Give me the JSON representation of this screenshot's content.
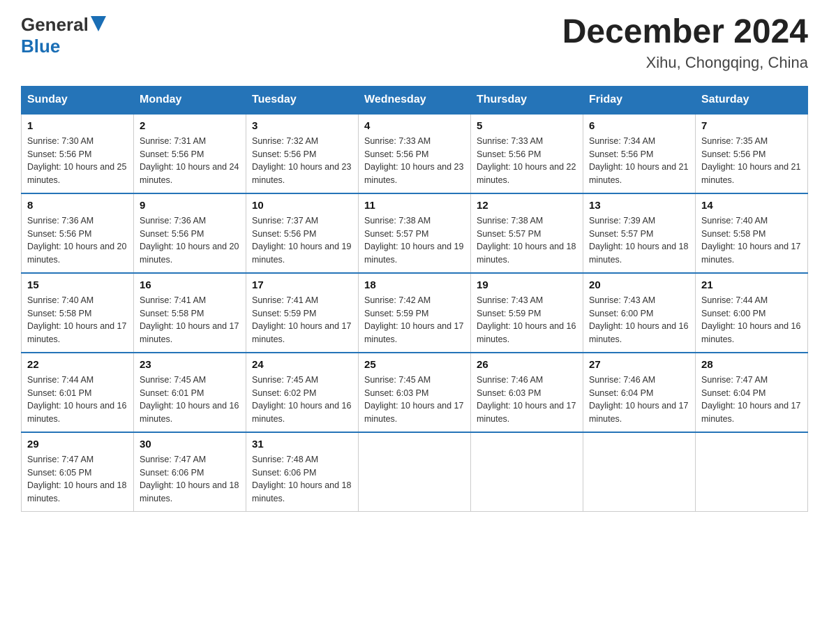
{
  "header": {
    "logo_general": "General",
    "logo_blue": "Blue",
    "month_title": "December 2024",
    "location": "Xihu, Chongqing, China"
  },
  "weekdays": [
    "Sunday",
    "Monday",
    "Tuesday",
    "Wednesday",
    "Thursday",
    "Friday",
    "Saturday"
  ],
  "weeks": [
    [
      {
        "day": "1",
        "sunrise": "7:30 AM",
        "sunset": "5:56 PM",
        "daylight": "10 hours and 25 minutes."
      },
      {
        "day": "2",
        "sunrise": "7:31 AM",
        "sunset": "5:56 PM",
        "daylight": "10 hours and 24 minutes."
      },
      {
        "day": "3",
        "sunrise": "7:32 AM",
        "sunset": "5:56 PM",
        "daylight": "10 hours and 23 minutes."
      },
      {
        "day": "4",
        "sunrise": "7:33 AM",
        "sunset": "5:56 PM",
        "daylight": "10 hours and 23 minutes."
      },
      {
        "day": "5",
        "sunrise": "7:33 AM",
        "sunset": "5:56 PM",
        "daylight": "10 hours and 22 minutes."
      },
      {
        "day": "6",
        "sunrise": "7:34 AM",
        "sunset": "5:56 PM",
        "daylight": "10 hours and 21 minutes."
      },
      {
        "day": "7",
        "sunrise": "7:35 AM",
        "sunset": "5:56 PM",
        "daylight": "10 hours and 21 minutes."
      }
    ],
    [
      {
        "day": "8",
        "sunrise": "7:36 AM",
        "sunset": "5:56 PM",
        "daylight": "10 hours and 20 minutes."
      },
      {
        "day": "9",
        "sunrise": "7:36 AM",
        "sunset": "5:56 PM",
        "daylight": "10 hours and 20 minutes."
      },
      {
        "day": "10",
        "sunrise": "7:37 AM",
        "sunset": "5:56 PM",
        "daylight": "10 hours and 19 minutes."
      },
      {
        "day": "11",
        "sunrise": "7:38 AM",
        "sunset": "5:57 PM",
        "daylight": "10 hours and 19 minutes."
      },
      {
        "day": "12",
        "sunrise": "7:38 AM",
        "sunset": "5:57 PM",
        "daylight": "10 hours and 18 minutes."
      },
      {
        "day": "13",
        "sunrise": "7:39 AM",
        "sunset": "5:57 PM",
        "daylight": "10 hours and 18 minutes."
      },
      {
        "day": "14",
        "sunrise": "7:40 AM",
        "sunset": "5:58 PM",
        "daylight": "10 hours and 17 minutes."
      }
    ],
    [
      {
        "day": "15",
        "sunrise": "7:40 AM",
        "sunset": "5:58 PM",
        "daylight": "10 hours and 17 minutes."
      },
      {
        "day": "16",
        "sunrise": "7:41 AM",
        "sunset": "5:58 PM",
        "daylight": "10 hours and 17 minutes."
      },
      {
        "day": "17",
        "sunrise": "7:41 AM",
        "sunset": "5:59 PM",
        "daylight": "10 hours and 17 minutes."
      },
      {
        "day": "18",
        "sunrise": "7:42 AM",
        "sunset": "5:59 PM",
        "daylight": "10 hours and 17 minutes."
      },
      {
        "day": "19",
        "sunrise": "7:43 AM",
        "sunset": "5:59 PM",
        "daylight": "10 hours and 16 minutes."
      },
      {
        "day": "20",
        "sunrise": "7:43 AM",
        "sunset": "6:00 PM",
        "daylight": "10 hours and 16 minutes."
      },
      {
        "day": "21",
        "sunrise": "7:44 AM",
        "sunset": "6:00 PM",
        "daylight": "10 hours and 16 minutes."
      }
    ],
    [
      {
        "day": "22",
        "sunrise": "7:44 AM",
        "sunset": "6:01 PM",
        "daylight": "10 hours and 16 minutes."
      },
      {
        "day": "23",
        "sunrise": "7:45 AM",
        "sunset": "6:01 PM",
        "daylight": "10 hours and 16 minutes."
      },
      {
        "day": "24",
        "sunrise": "7:45 AM",
        "sunset": "6:02 PM",
        "daylight": "10 hours and 16 minutes."
      },
      {
        "day": "25",
        "sunrise": "7:45 AM",
        "sunset": "6:03 PM",
        "daylight": "10 hours and 17 minutes."
      },
      {
        "day": "26",
        "sunrise": "7:46 AM",
        "sunset": "6:03 PM",
        "daylight": "10 hours and 17 minutes."
      },
      {
        "day": "27",
        "sunrise": "7:46 AM",
        "sunset": "6:04 PM",
        "daylight": "10 hours and 17 minutes."
      },
      {
        "day": "28",
        "sunrise": "7:47 AM",
        "sunset": "6:04 PM",
        "daylight": "10 hours and 17 minutes."
      }
    ],
    [
      {
        "day": "29",
        "sunrise": "7:47 AM",
        "sunset": "6:05 PM",
        "daylight": "10 hours and 18 minutes."
      },
      {
        "day": "30",
        "sunrise": "7:47 AM",
        "sunset": "6:06 PM",
        "daylight": "10 hours and 18 minutes."
      },
      {
        "day": "31",
        "sunrise": "7:48 AM",
        "sunset": "6:06 PM",
        "daylight": "10 hours and 18 minutes."
      },
      null,
      null,
      null,
      null
    ]
  ]
}
